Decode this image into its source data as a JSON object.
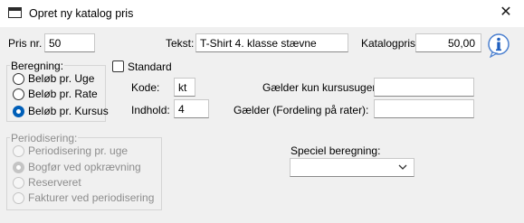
{
  "window": {
    "title": "Opret ny katalog pris",
    "close_glyph": "✕"
  },
  "fields": {
    "pris_nr": {
      "label": "Pris nr.",
      "value": "50"
    },
    "tekst": {
      "label": "Tekst:",
      "value": "T-Shirt 4. klasse stævne"
    },
    "katalogpris": {
      "label": "Katalogpris:",
      "value": "50,00"
    },
    "kode": {
      "label": "Kode:",
      "value": "kt"
    },
    "indhold": {
      "label": "Indhold:",
      "value": "4"
    },
    "kursusuger": {
      "label": "Gælder kun kursusuger:",
      "value": ""
    },
    "fordeling": {
      "label": "Gælder (Fordeling på rater):",
      "value": ""
    },
    "speciel": {
      "label": "Speciel beregning:",
      "value": ""
    }
  },
  "standard_checkbox": {
    "label": "Standard",
    "checked": false
  },
  "beregning": {
    "title": "Beregning:",
    "options": [
      {
        "label": "Beløb pr. Uge",
        "selected": false
      },
      {
        "label": "Beløb pr. Rate",
        "selected": false
      },
      {
        "label": "Beløb pr. Kursus",
        "selected": true
      }
    ]
  },
  "periodisering": {
    "title": "Periodisering:",
    "enabled": false,
    "options": [
      {
        "label": "Periodisering pr. uge",
        "selected": false
      },
      {
        "label": "Bogfør ved opkrævning",
        "selected": true
      },
      {
        "label": "Reserveret",
        "selected": false
      },
      {
        "label": "Fakturer ved periodisering",
        "selected": false
      }
    ]
  },
  "icons": {
    "title": "window-icon",
    "info": "info-icon",
    "close": "close-icon",
    "dropdown": "chevron-down-icon"
  },
  "colors": {
    "accent": "#005fb8",
    "info_blue": "#1f5fbf"
  }
}
